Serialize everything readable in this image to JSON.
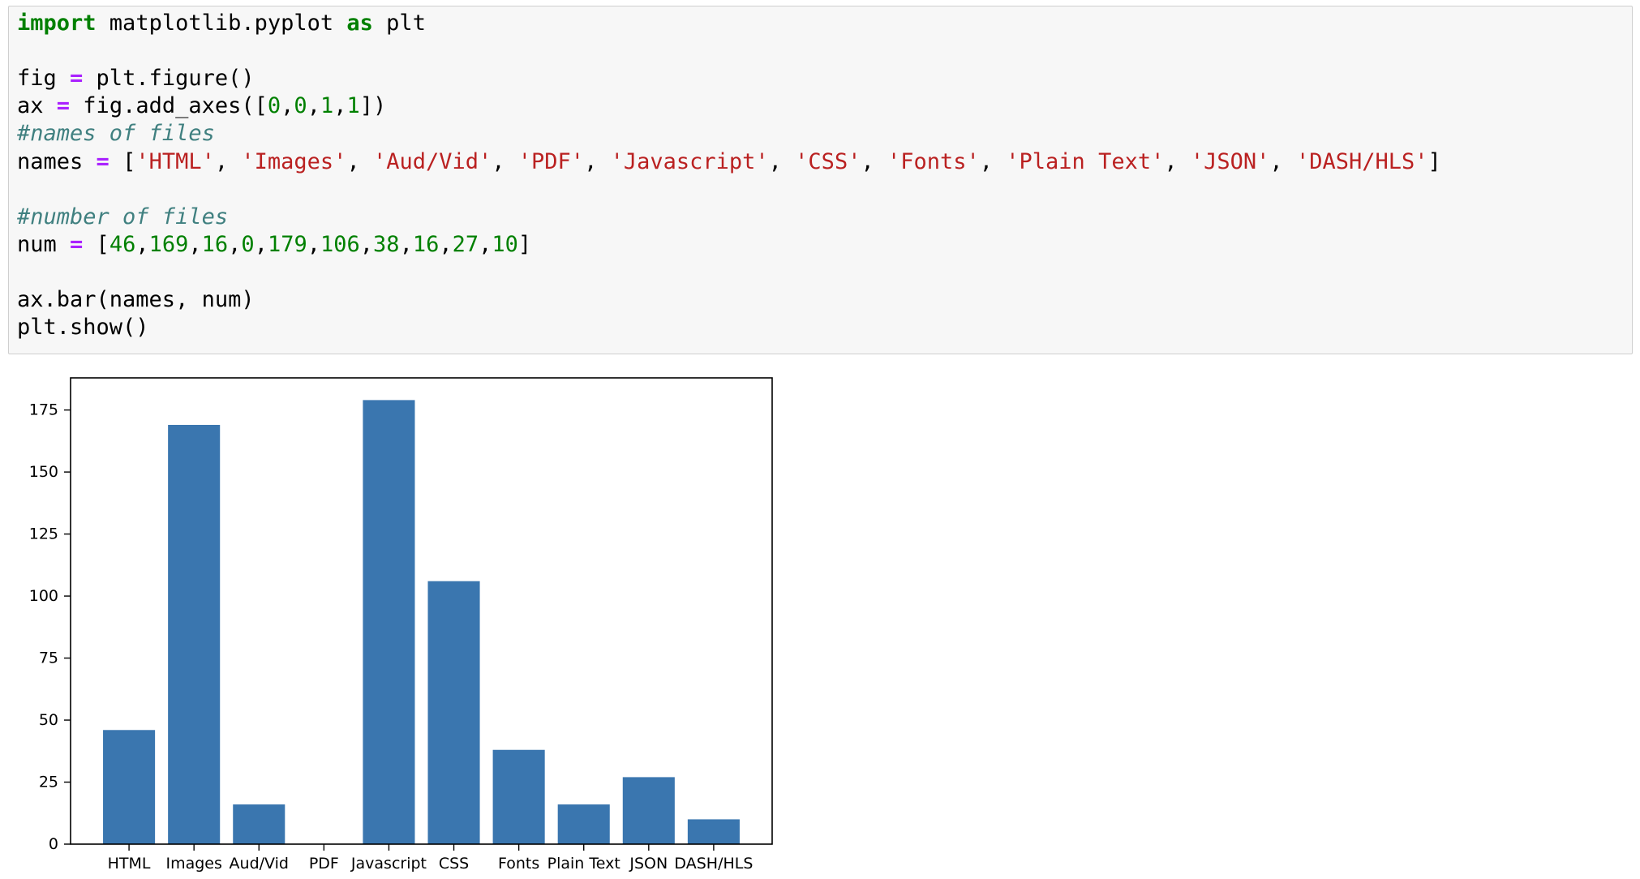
{
  "code_cell": {
    "lines": [
      [
        {
          "t": "import",
          "c": "kw"
        },
        {
          "t": " matplotlib.pyplot "
        },
        {
          "t": "as",
          "c": "kw"
        },
        {
          "t": " plt"
        }
      ],
      [],
      [
        {
          "t": "fig "
        },
        {
          "t": "=",
          "c": "op"
        },
        {
          "t": " plt.figure()"
        }
      ],
      [
        {
          "t": "ax "
        },
        {
          "t": "=",
          "c": "op"
        },
        {
          "t": " fig.add_axes(["
        },
        {
          "t": "0",
          "c": "num"
        },
        {
          "t": ","
        },
        {
          "t": "0",
          "c": "num"
        },
        {
          "t": ","
        },
        {
          "t": "1",
          "c": "num"
        },
        {
          "t": ","
        },
        {
          "t": "1",
          "c": "num"
        },
        {
          "t": "])"
        }
      ],
      [
        {
          "t": "#names of files",
          "c": "cm"
        }
      ],
      [
        {
          "t": "names "
        },
        {
          "t": "=",
          "c": "op"
        },
        {
          "t": " ["
        },
        {
          "t": "'HTML'",
          "c": "str"
        },
        {
          "t": ", "
        },
        {
          "t": "'Images'",
          "c": "str"
        },
        {
          "t": ", "
        },
        {
          "t": "'Aud/Vid'",
          "c": "str"
        },
        {
          "t": ", "
        },
        {
          "t": "'PDF'",
          "c": "str"
        },
        {
          "t": ", "
        },
        {
          "t": "'Javascript'",
          "c": "str"
        },
        {
          "t": ", "
        },
        {
          "t": "'CSS'",
          "c": "str"
        },
        {
          "t": ", "
        },
        {
          "t": "'Fonts'",
          "c": "str"
        },
        {
          "t": ", "
        },
        {
          "t": "'Plain Text'",
          "c": "str"
        },
        {
          "t": ", "
        },
        {
          "t": "'JSON'",
          "c": "str"
        },
        {
          "t": ", "
        },
        {
          "t": "'DASH/HLS'",
          "c": "str"
        },
        {
          "t": "]"
        }
      ],
      [],
      [
        {
          "t": "#number of files",
          "c": "cm"
        }
      ],
      [
        {
          "t": "num "
        },
        {
          "t": "=",
          "c": "op"
        },
        {
          "t": " ["
        },
        {
          "t": "46",
          "c": "num"
        },
        {
          "t": ","
        },
        {
          "t": "169",
          "c": "num"
        },
        {
          "t": ","
        },
        {
          "t": "16",
          "c": "num"
        },
        {
          "t": ","
        },
        {
          "t": "0",
          "c": "num"
        },
        {
          "t": ","
        },
        {
          "t": "179",
          "c": "num"
        },
        {
          "t": ","
        },
        {
          "t": "106",
          "c": "num"
        },
        {
          "t": ","
        },
        {
          "t": "38",
          "c": "num"
        },
        {
          "t": ","
        },
        {
          "t": "16",
          "c": "num"
        },
        {
          "t": ","
        },
        {
          "t": "27",
          "c": "num"
        },
        {
          "t": ","
        },
        {
          "t": "10",
          "c": "num"
        },
        {
          "t": "]"
        }
      ],
      [],
      [
        {
          "t": "ax.bar(names, num)"
        }
      ],
      [
        {
          "t": "plt.show()"
        }
      ]
    ],
    "colors": {
      "keyword": "#008000",
      "operator": "#aa22ff",
      "number": "#008000",
      "string": "#ba2121",
      "comment": "#408080"
    }
  },
  "chart_data": {
    "type": "bar",
    "categories": [
      "HTML",
      "Images",
      "Aud/Vid",
      "PDF",
      "Javascript",
      "CSS",
      "Fonts",
      "Plain Text",
      "JSON",
      "DASH/HLS"
    ],
    "values": [
      46,
      169,
      16,
      0,
      179,
      106,
      38,
      16,
      27,
      10
    ],
    "yticks": [
      0,
      25,
      50,
      75,
      100,
      125,
      150,
      175
    ],
    "ylim": [
      0,
      187.95
    ],
    "bar_color": "#3a76af",
    "title": "",
    "xlabel": "",
    "ylabel": "",
    "grid": false
  }
}
